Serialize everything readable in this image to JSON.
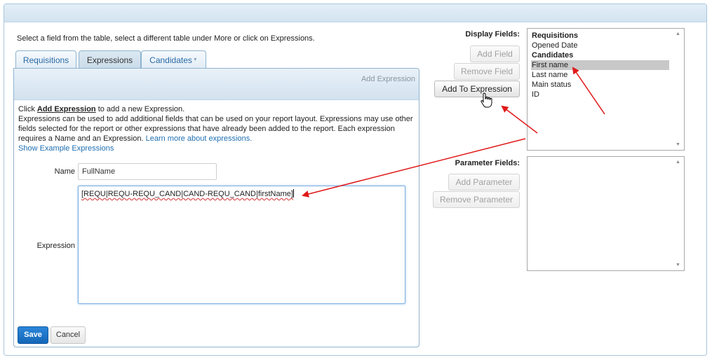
{
  "instruction": "Select a field from the table, select a different table under More or click on Expressions.",
  "tabs": [
    {
      "label": "Requisitions"
    },
    {
      "label": "Expressions"
    },
    {
      "label": "Candidates"
    }
  ],
  "tab_caret_icon": "dropdown-caret",
  "panel": {
    "add_expression_link": "Add Expression",
    "help_prefix": "Click ",
    "help_link": "Add Expression",
    "help_suffix": " to add a new Expression.",
    "help_body": "Expressions can be used to add additional fields that can be used on your report layout. Expressions may use other fields selected for the report or other expressions that have already been added to the report. Each expression requires a Name and an Expression. ",
    "learn_more": "Learn more about expressions.",
    "show_examples": "Show Example Expressions",
    "name_label": "Name",
    "name_value": "FullName",
    "expression_label": "Expression",
    "expression_value": "[REQU|REQU-REQU_CAND|CAND-REQU_CAND|firstName]",
    "save_label": "Save",
    "cancel_label": "Cancel"
  },
  "display_fields": {
    "label": "Display Fields:",
    "buttons": {
      "add_field": "Add Field",
      "remove_field": "Remove Field",
      "add_to_expression": "Add To Expression"
    },
    "items": [
      {
        "text": "Requisitions",
        "group": true
      },
      {
        "text": "Opened Date",
        "group": false
      },
      {
        "text": "Candidates",
        "group": true
      },
      {
        "text": "First name",
        "group": false,
        "selected": true
      },
      {
        "text": "Last name",
        "group": false
      },
      {
        "text": "Main status",
        "group": false
      },
      {
        "text": "ID",
        "group": false
      }
    ]
  },
  "parameter_fields": {
    "label": "Parameter Fields:",
    "buttons": {
      "add_parameter": "Add Parameter",
      "remove_parameter": "Remove Parameter"
    }
  },
  "colors": {
    "annotation_arrow": "#e01818",
    "tab_link": "#2a6aa6",
    "save_button": "#1a6fc4",
    "selected_item": "#c8c8c8"
  }
}
